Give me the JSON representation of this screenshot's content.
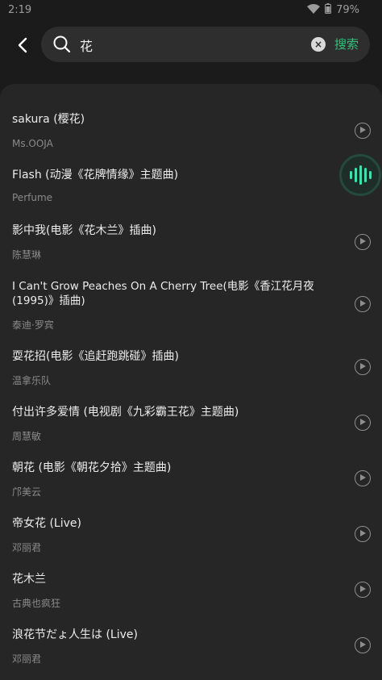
{
  "status": {
    "time": "2:19",
    "battery": "79%"
  },
  "search": {
    "query": "花",
    "clear_icon": "×",
    "button_label": "搜索"
  },
  "results": [
    {
      "title": "sakura (樱花)",
      "artist": "Ms.OOJA"
    },
    {
      "title": "Flash (动漫《花牌情缘》主题曲)",
      "artist": "Perfume"
    },
    {
      "title": "影中我(电影《花木兰》插曲)",
      "artist": "陈慧琳"
    },
    {
      "title": "I Can't Grow Peaches On A Cherry Tree(电影《香江花月夜(1995)》插曲)",
      "artist": "泰迪·罗宾"
    },
    {
      "title": "耍花招(电影《追赶跑跳碰》插曲)",
      "artist": "温拿乐队"
    },
    {
      "title": "付出许多爱情 (电视剧《九彩霸王花》主题曲)",
      "artist": "周慧敏"
    },
    {
      "title": "朝花 (电影《朝花夕拾》主题曲)",
      "artist": "邝美云"
    },
    {
      "title": "帝女花 (Live)",
      "artist": "邓丽君"
    },
    {
      "title": "花木兰",
      "artist": "古典也疯狂"
    },
    {
      "title": "浪花节だょ人生は (Live)",
      "artist": "邓丽君"
    }
  ],
  "colors": {
    "accent": "#31c27c",
    "background": "#1b1b1b",
    "panel": "#262626"
  }
}
